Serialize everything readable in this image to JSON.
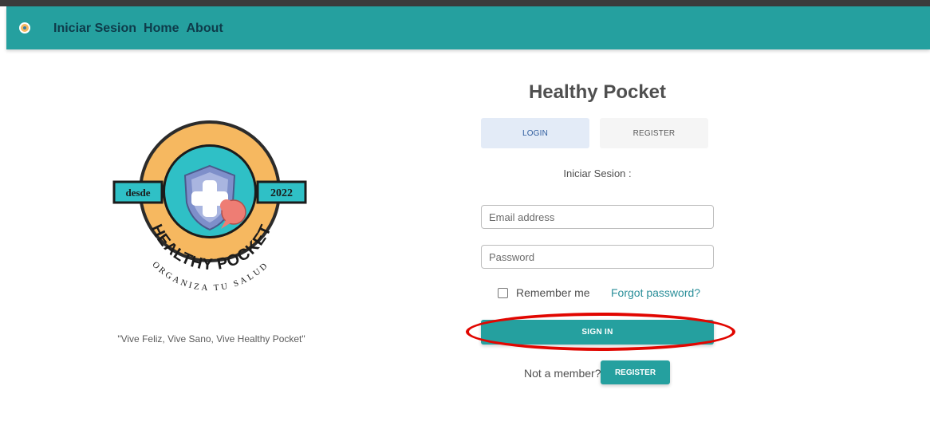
{
  "colors": {
    "navbar": "#25a09f",
    "nav_text": "#0e3b4a",
    "primary_button": "#25a09f",
    "link": "#2b8f9a",
    "login_tab_bg": "#e3ebf7",
    "highlight_annotation": "#e10600",
    "logo_outer": "#f6b860",
    "logo_inner": "#2fc0c6",
    "logo_shield": "#7e8fca",
    "logo_bubble": "#ee7d74"
  },
  "navbar": {
    "brand_icon": "logo-circle-icon",
    "links": [
      "Iniciar Sesion",
      "Home",
      "About"
    ]
  },
  "logo": {
    "left_banner": "desde",
    "right_banner": "2022",
    "arc_title": "HEALTHY POCKET",
    "bottom_text": "ORGANIZA TU SALUD",
    "icon": "medical-shield-icon"
  },
  "slogan": "\"Vive Feliz, Vive Sano, Vive Healthy Pocket\"",
  "form": {
    "title": "Healthy Pocket",
    "tabs": {
      "login": "LOGIN",
      "register": "REGISTER"
    },
    "subtitle": "Iniciar Sesion :",
    "email_placeholder": "Email address",
    "password_placeholder": "Password",
    "remember_label": "Remember me",
    "forgot_label": "Forgot password?",
    "signin_label": "SIGN IN",
    "not_member_text": "Not a member?",
    "register_button_label": "REGISTER"
  }
}
